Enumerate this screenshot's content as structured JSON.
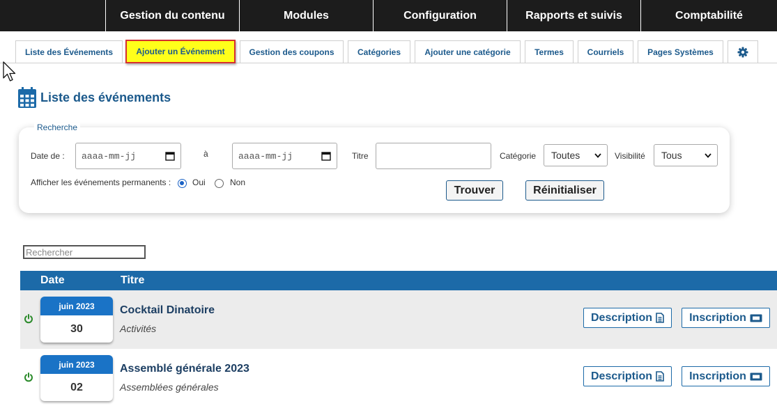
{
  "topnav": [
    "Gestion du contenu",
    "Modules",
    "Configuration",
    "Rapports et suivis",
    "Comptabilité"
  ],
  "tabs": [
    "Liste des Événements",
    "Ajouter un Événement",
    "Gestion des coupons",
    "Catégories",
    "Ajouter une catégorie",
    "Termes",
    "Courriels",
    "Pages Systèmes"
  ],
  "active_tab": "Ajouter un Événement",
  "page_title": "Liste des événements",
  "search": {
    "legend": "Recherche",
    "date_from_label": "Date de :",
    "date_to_label": "à",
    "date_placeholder": "aaaa-mm-jj",
    "title_label": "Titre",
    "category_label": "Catégorie",
    "category_value": "Toutes",
    "visibility_label": "Visibilité",
    "visibility_value": "Tous",
    "permanent_label": "Afficher les événements permanents :",
    "yes_label": "Oui",
    "no_label": "Non",
    "yes_checked": true,
    "find_button": "Trouver",
    "reset_button": "Réinitialiser"
  },
  "table": {
    "search_placeholder": "Rechercher",
    "headers": {
      "date": "Date",
      "title": "Titre"
    },
    "rows": [
      {
        "month": "juin 2023",
        "day": "30",
        "title": "Cocktail Dinatoire",
        "category": "Activités"
      },
      {
        "month": "juin 2023",
        "day": "02",
        "title": "Assemblé générale 2023",
        "category": "Assemblées générales"
      }
    ],
    "description_label": "Description",
    "register_label": "Inscription"
  },
  "colors": {
    "nav_bg": "#1c1c1c",
    "accent": "#1c6aa8",
    "active_tab_bg": "#ffff1a",
    "active_tab_border": "#d63030",
    "power_green": "#2a8a2a"
  }
}
